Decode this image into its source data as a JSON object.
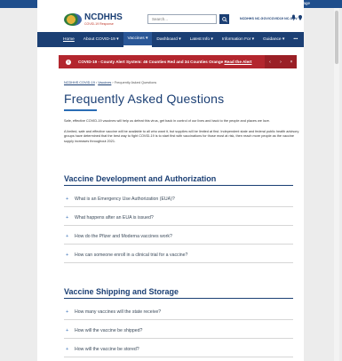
{
  "lang": {
    "label": "Select Language"
  },
  "header": {
    "logo_title": "NCDHHS",
    "logo_sub": "COVID-19 Response",
    "search_placeholder": "Search...",
    "site_links": "NCDHHS  NC.GOV/COVID19  NC.GOV"
  },
  "nav": [
    {
      "label": "Home"
    },
    {
      "label": "About COVID-19 ▾"
    },
    {
      "label": "Vaccines ▾"
    },
    {
      "label": "Dashboard ▾"
    },
    {
      "label": "Latest Info ▾"
    },
    {
      "label": "Information For ▾"
    },
    {
      "label": "Guidance ▾"
    },
    {
      "label": "•••"
    }
  ],
  "alert": {
    "icon": "!",
    "text": "COVID-19 - County Alert System: 46 Counties Red and 34 Counties Orange",
    "link": "Read the Alert",
    "prev": "‹",
    "next": "›",
    "close": "×"
  },
  "breadcrumb": {
    "home": "NCDHHS COVID-19",
    "section": "Vaccines",
    "current": "Frequently Asked Questions"
  },
  "page": {
    "title": "Frequently Asked Questions",
    "intro1": "Safe, effective COVID-19 vaccines will help us defeat this virus, get back in control of our lives and back to the people and places we love.",
    "intro2": "A limited, safe and effective vaccine will be available to all who want it, but supplies will be limited at first. Independent state and federal public health advisory groups have determined that the best way to fight COVID-19 is to start first with vaccinations for those most at risk, then reach more people as the vaccine supply increases throughout 2021."
  },
  "sections": [
    {
      "title": "Vaccine Development and Authorization",
      "questions": [
        "What is an Emergency Use Authorization (EUA)?",
        "What happens after an EUA is issued?",
        "How do the Pfizer and Moderna vaccines work?",
        "How can someone enroll in a clinical trial for a vaccine?"
      ]
    },
    {
      "title": "Vaccine Shipping and Storage",
      "questions": [
        "How many vaccines will the state receive?",
        "How will the vaccine be shipped?",
        "How will the vaccine be stored?"
      ]
    }
  ],
  "colors": {
    "brand": "#1b3f74",
    "alert": "#b3262e",
    "accent": "#2a6db5"
  }
}
